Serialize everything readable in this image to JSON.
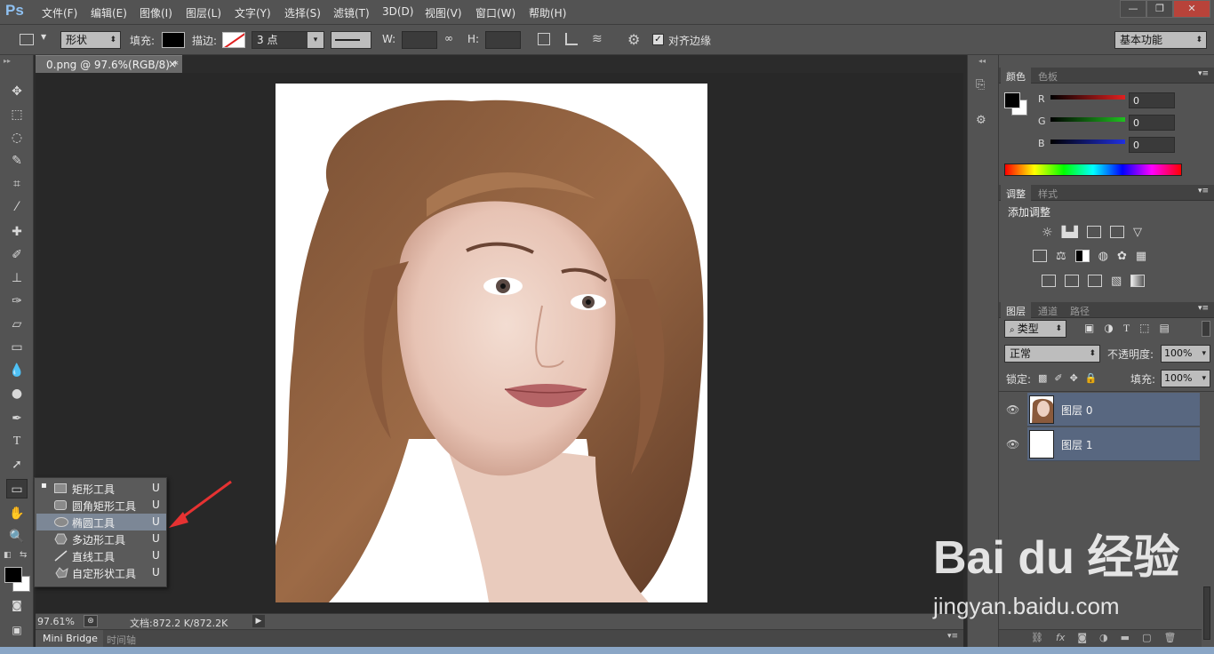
{
  "app": {
    "logo": "Ps"
  },
  "menu": [
    "文件(F)",
    "编辑(E)",
    "图像(I)",
    "图层(L)",
    "文字(Y)",
    "选择(S)",
    "滤镜(T)",
    "3D(D)",
    "视图(V)",
    "窗口(W)",
    "帮助(H)"
  ],
  "window_buttons": {
    "minimize": "—",
    "restore": "❐",
    "close": "✕"
  },
  "options": {
    "mode": "形状",
    "fill_label": "填充:",
    "stroke_label": "描边:",
    "stroke_width": "3 点",
    "w_label": "W:",
    "h_label": "H:",
    "align_label": "对齐边缘",
    "workspace": "基本功能"
  },
  "document": {
    "tab_title": "0.png @ 97.6%(RGB/8) *",
    "tab_close": "×",
    "zoom": "97.61%",
    "doc_info": "文档:872.2 K/872.2K"
  },
  "bottom_tabs": [
    "Mini Bridge",
    "时间轴"
  ],
  "flyout": {
    "items": [
      {
        "label": "矩形工具",
        "key": "U",
        "icon": "rect-icon",
        "active_dot": "▪"
      },
      {
        "label": "圆角矩形工具",
        "key": "U",
        "icon": "rounded-rect-icon"
      },
      {
        "label": "椭圆工具",
        "key": "U",
        "icon": "ellipse-icon"
      },
      {
        "label": "多边形工具",
        "key": "U",
        "icon": "polygon-icon"
      },
      {
        "label": "直线工具",
        "key": "U",
        "icon": "line-icon"
      },
      {
        "label": "自定形状工具",
        "key": "U",
        "icon": "custom-shape-icon"
      }
    ]
  },
  "color_panel": {
    "tabs": [
      "颜色",
      "色板"
    ],
    "channels": [
      {
        "label": "R",
        "value": "0",
        "color": "#e02020"
      },
      {
        "label": "G",
        "value": "0",
        "color": "#20c020"
      },
      {
        "label": "B",
        "value": "0",
        "color": "#2030e0"
      }
    ]
  },
  "adjust_panel": {
    "tabs": [
      "调整",
      "样式"
    ],
    "title": "添加调整"
  },
  "layers_panel": {
    "tabs": [
      "图层",
      "通道",
      "路径"
    ],
    "filter_kind": "类型",
    "blend_mode": "正常",
    "opacity_label": "不透明度:",
    "opacity_value": "100%",
    "lock_label": "锁定:",
    "fill_label": "填充:",
    "fill_value": "100%",
    "layers": [
      {
        "name": "图层 0"
      },
      {
        "name": "图层 1"
      }
    ]
  },
  "watermark": {
    "brand": "Bai du 经验",
    "url": "jingyan.baidu.com"
  },
  "colors": {
    "accent": "#8fc1f2",
    "selected_layer": "#586780",
    "arrow": "#e63232"
  }
}
